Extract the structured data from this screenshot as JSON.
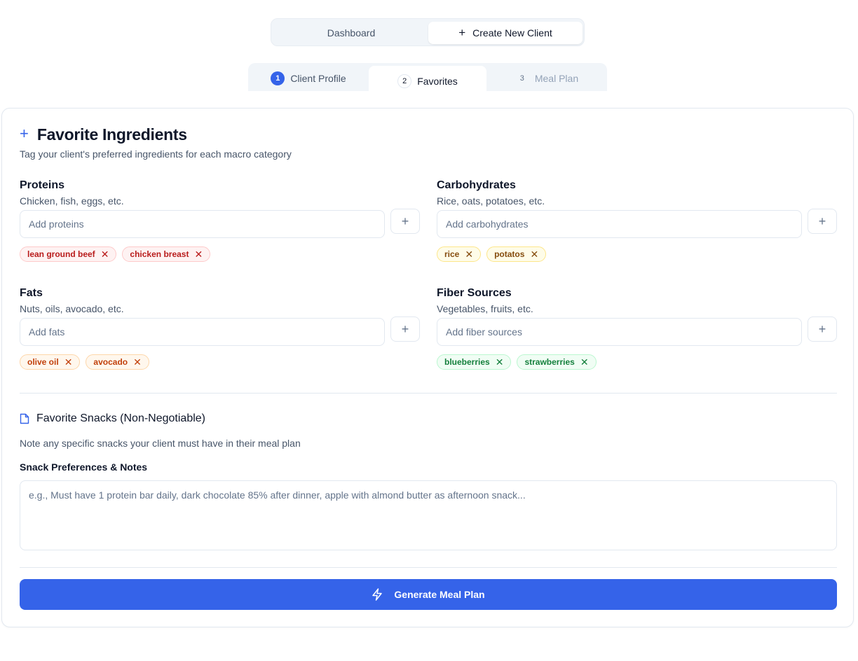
{
  "nav": {
    "dashboard_label": "Dashboard",
    "create_label": "Create New Client",
    "create_icon": "+"
  },
  "steps": [
    {
      "number": "1",
      "label": "Client Profile",
      "state": "complete"
    },
    {
      "number": "2",
      "label": "Favorites",
      "state": "active"
    },
    {
      "number": "3",
      "label": "Meal Plan",
      "state": "upcoming"
    }
  ],
  "card": {
    "icon": "+",
    "title": "Favorite Ingredients",
    "subtitle": "Tag your client's preferred ingredients for each macro category"
  },
  "groups": {
    "proteins": {
      "title": "Proteins",
      "hint": "Chicken, fish, eggs, etc.",
      "placeholder": "Add proteins",
      "add_icon": "+",
      "tags": [
        "lean ground beef",
        "chicken breast"
      ],
      "color": {
        "bg": "#fef2f2",
        "border": "#fecaca",
        "text": "#b91c1c"
      }
    },
    "carbs": {
      "title": "Carbohydrates",
      "hint": "Rice, oats, potatoes, etc.",
      "placeholder": "Add carbohydrates",
      "add_icon": "+",
      "tags": [
        "rice",
        "potatos"
      ],
      "color": {
        "bg": "#fefce8",
        "border": "#fde68a",
        "text": "#854d0e"
      }
    },
    "fats": {
      "title": "Fats",
      "hint": "Nuts, oils, avocado, etc.",
      "placeholder": "Add fats",
      "add_icon": "+",
      "tags": [
        "olive oil",
        "avocado"
      ],
      "color": {
        "bg": "#fff7ed",
        "border": "#fed7aa",
        "text": "#c2410c"
      }
    },
    "fiber": {
      "title": "Fiber Sources",
      "hint": "Vegetables, fruits, etc.",
      "placeholder": "Add fiber sources",
      "add_icon": "+",
      "tags": [
        "blueberries",
        "strawberries"
      ],
      "color": {
        "bg": "#f0fdf4",
        "border": "#bbf7d0",
        "text": "#15803d"
      }
    }
  },
  "tag_remove_icon": "✕",
  "snacks": {
    "title": "Favorite Snacks (Non-Negotiable)",
    "subtitle": "Note any specific snacks your client must have in their meal plan",
    "label": "Snack Preferences & Notes",
    "placeholder": "e.g., Must have 1 protein bar daily, dark chocolate 85% after dinner, apple with almond butter as afternoon snack...",
    "value": ""
  },
  "generate_button": {
    "label": "Generate Meal Plan",
    "icon": "lightning-icon"
  },
  "colors": {
    "accent": "#3563e9",
    "border": "#e2e8f0",
    "muted_text": "#475569"
  }
}
